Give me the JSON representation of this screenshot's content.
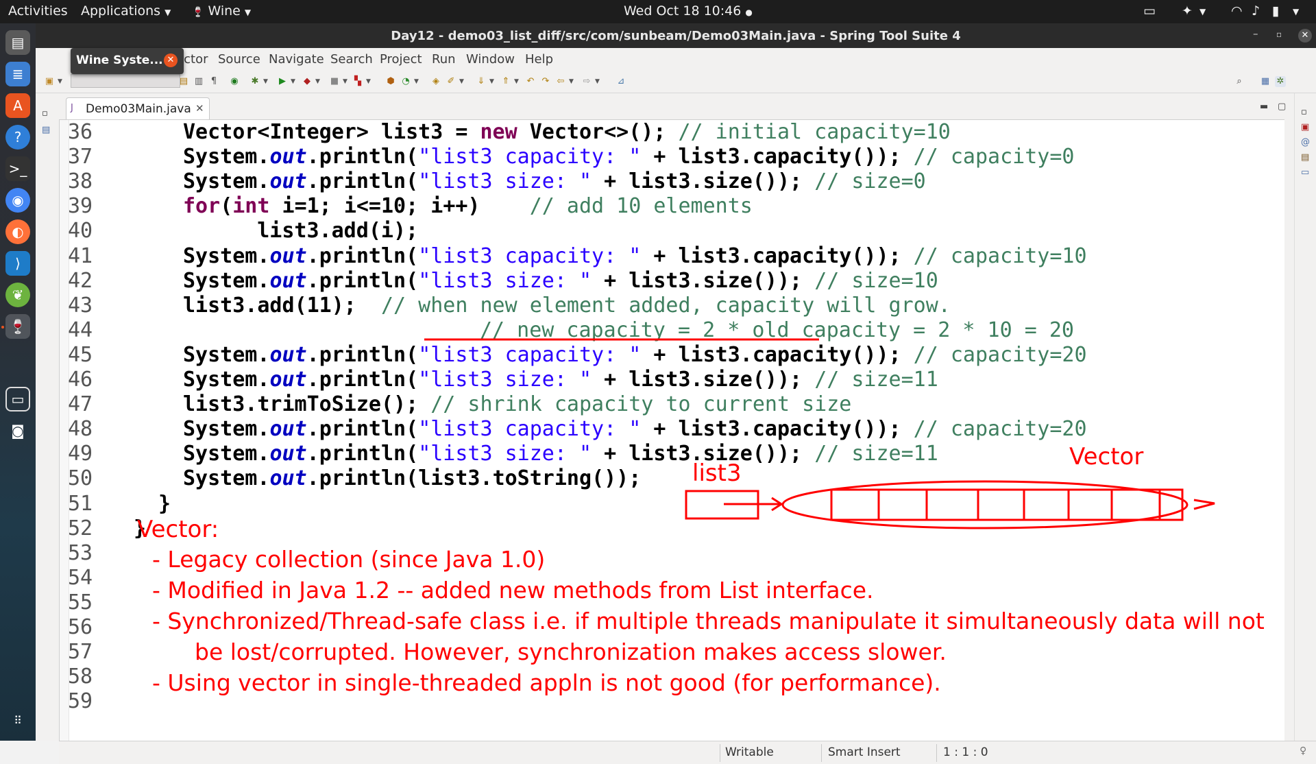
{
  "topbar": {
    "activities": "Activities",
    "applications": "Applications",
    "wine": "Wine",
    "clock": "Wed Oct 18  10:46"
  },
  "window": {
    "title": "Day12 - demo03_list_diff/src/com/sunbeam/Demo03Main.java - Spring Tool Suite 4"
  },
  "wine_popup": {
    "label": "Wine Syste..."
  },
  "menu": {
    "items": [
      "Refactor",
      "Source",
      "Navigate",
      "Search",
      "Project",
      "Run",
      "Window",
      "Help"
    ]
  },
  "editor_tab": {
    "label": "Demo03Main.java"
  },
  "code_lines": [
    {
      "n": "36",
      "text": "        Vector<Integer> list3 = new Vector<>(); // initial capacity=10"
    },
    {
      "n": "37",
      "text": "        System.out.println(\"list3 capacity: \" + list3.capacity()); // capacity=0"
    },
    {
      "n": "38",
      "text": "        System.out.println(\"list3 size: \" + list3.size()); // size=0"
    },
    {
      "n": "39",
      "text": "        for(int i=1; i<=10; i++)    // add 10 elements"
    },
    {
      "n": "40",
      "text": "            list3.add(i);"
    },
    {
      "n": "41",
      "text": "        System.out.println(\"list3 capacity: \" + list3.capacity()); // capacity=10"
    },
    {
      "n": "42",
      "text": "        System.out.println(\"list3 size: \" + list3.size()); // size=10"
    },
    {
      "n": "43",
      "text": "        list3.add(11);  // when new element added, capacity will grow."
    },
    {
      "n": "44",
      "text": "                        // new capacity = 2 * old capacity = 2 * 10 = 20"
    },
    {
      "n": "45",
      "text": "        System.out.println(\"list3 capacity: \" + list3.capacity()); // capacity=20"
    },
    {
      "n": "46",
      "text": "        System.out.println(\"list3 size: \" + list3.size()); // size=11"
    },
    {
      "n": "47",
      "text": "        list3.trimToSize(); // shrink capacity to current size"
    },
    {
      "n": "48",
      "text": "        System.out.println(\"list3 capacity: \" + list3.capacity()); // capacity=20"
    },
    {
      "n": "49",
      "text": "        System.out.println(\"list3 size: \" + list3.size()); // size=11"
    },
    {
      "n": "50",
      "text": "        System.out.println(list3.toString());"
    },
    {
      "n": "51",
      "text": "    }"
    },
    {
      "n": "52",
      "text": "}"
    },
    {
      "n": "53",
      "text": ""
    },
    {
      "n": "54",
      "text": ""
    },
    {
      "n": "55",
      "text": ""
    },
    {
      "n": "56",
      "text": ""
    },
    {
      "n": "57",
      "text": ""
    },
    {
      "n": "58",
      "text": ""
    },
    {
      "n": "59",
      "text": ""
    }
  ],
  "annotations": {
    "list3_label": "list3",
    "vector_label": "Vector",
    "notes_title": "Vector:",
    "note1": "- Legacy collection (since Java 1.0)",
    "note2": "- Modified in Java 1.2 -- added new methods from List interface.",
    "note3a": "- Synchronized/Thread-safe class i.e. if multiple threads manipulate it simultaneously data will not",
    "note3b": "be lost/corrupted. However, synchronization makes access slower.",
    "note4": "- Using vector in single-threaded appln is not good (for performance).",
    "ink_color": "#ff0000"
  },
  "statusbar": {
    "writable": "Writable",
    "insert_mode": "Smart Insert",
    "position": "1 : 1 : 0"
  },
  "colors": {
    "keyword": "#7f0055",
    "field": "#0000c0",
    "string": "#2a00ff",
    "comment": "#3f7f5f",
    "annotation": "#ff0000"
  }
}
